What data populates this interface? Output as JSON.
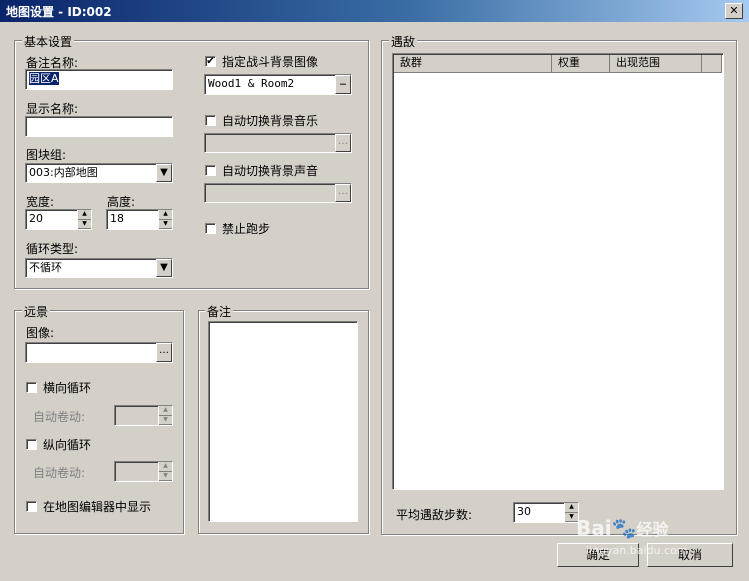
{
  "window": {
    "title": "地图设置 - ID:002",
    "close_icon": "close-icon"
  },
  "basic": {
    "legend": "基本设置",
    "note_name_label": "备注名称:",
    "note_name_value": "园区A",
    "display_name_label": "显示名称:",
    "display_name_value": "",
    "tileset_label": "图块组:",
    "tileset_value": "003:内部地图",
    "width_label": "宽度:",
    "width_value": "20",
    "height_label": "高度:",
    "height_value": "18",
    "loop_type_label": "循环类型:",
    "loop_type_value": "不循环",
    "battleback_check_label": "指定战斗背景图像",
    "battleback_checked": true,
    "battleback_value": "Wood1 & Room2",
    "autobgm_label": "自动切换背景音乐",
    "autobgm_checked": false,
    "autobgs_label": "自动切换背景声音",
    "autobgs_checked": false,
    "disable_dash_label": "禁止跑步",
    "disable_dash_checked": false
  },
  "parallax": {
    "legend": "远景",
    "image_label": "图像:",
    "image_value": "",
    "loop_h_label": "横向循环",
    "loop_h_scroll_label": "自动卷动:",
    "loop_v_label": "纵向循环",
    "loop_v_scroll_label": "自动卷动:",
    "show_in_editor_label": "在地图编辑器中显示"
  },
  "memo": {
    "legend": "备注",
    "value": ""
  },
  "encounters": {
    "legend": "遇敌",
    "columns": [
      "敌群",
      "权重",
      "出现范围"
    ],
    "rows": [],
    "steps_label": "平均遇敌步数:",
    "steps_value": "30"
  },
  "buttons": {
    "ok": "确定",
    "cancel": "取消"
  },
  "watermark": {
    "brand": "Bai",
    "brand2": "经验",
    "url": "jingyan.baidu.com"
  },
  "colors": {
    "titlebar_start": "#0a246a",
    "titlebar_end": "#a6caf0",
    "dialog_bg": "#d4d0c8"
  }
}
